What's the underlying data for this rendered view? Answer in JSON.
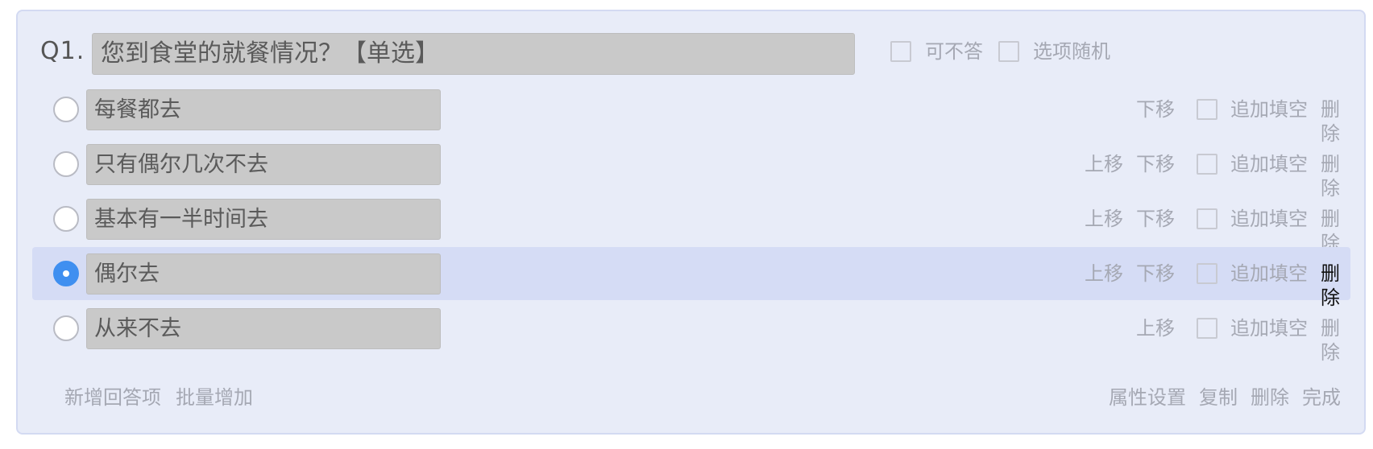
{
  "question": {
    "number": "Q1.",
    "title": "您到食堂的就餐情况？【单选】",
    "opt_optional": "可不答",
    "opt_random": "选项随机"
  },
  "options": [
    {
      "text": "每餐都去"
    },
    {
      "text": "只有偶尔几次不去"
    },
    {
      "text": "基本有一半时间去"
    },
    {
      "text": "偶尔去",
      "selected": true
    },
    {
      "text": "从来不去"
    }
  ],
  "row_actions": {
    "move_up": "上移",
    "move_down": "下移",
    "add_fill": "追加填空",
    "delete": "删除"
  },
  "footer": {
    "add_answer": "新增回答项",
    "batch_add": "批量增加",
    "properties": "属性设置",
    "copy": "复制",
    "delete": "删除",
    "done": "完成"
  },
  "colors": {
    "panel_bg": "#e8ecf8",
    "selected_row_bg": "#d5dcf5",
    "radio_accent": "#3f8ff0"
  }
}
